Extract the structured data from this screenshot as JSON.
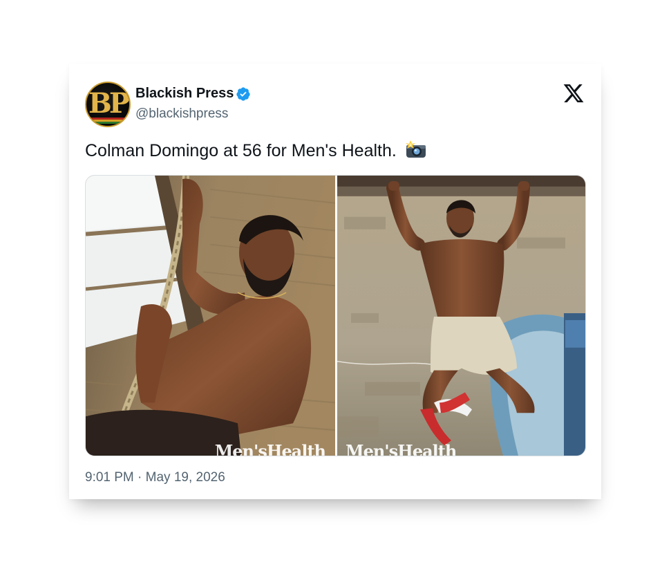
{
  "account": {
    "display_name": "Blackish Press",
    "handle": "@blackishpress",
    "avatar_text": "BP",
    "verified_icon": "verified-badge-icon"
  },
  "platform": {
    "logo_icon": "x-logo-icon"
  },
  "tweet": {
    "text": "Colman Domingo at 56 for Men's Health.",
    "emoji_icon": "camera-with-flash-icon",
    "timestamp": "9:01 PM · May 19, 2026"
  },
  "media": [
    {
      "watermark": "Men'sHealth",
      "description_icon": "photo-rope-climb"
    },
    {
      "watermark": "Men'sHealth",
      "description_icon": "photo-pullup-bar"
    }
  ],
  "colors": {
    "text_primary": "#0f1419",
    "text_secondary": "#536471",
    "verified_blue": "#1d9bf0",
    "avatar_gold": "#e2b44a"
  }
}
